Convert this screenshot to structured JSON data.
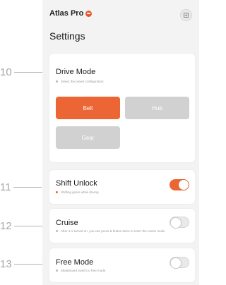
{
  "colors": {
    "accent": "#eb6634",
    "muted_option": "#d1d1d1",
    "panel_bg": "#f3f3f3"
  },
  "annotations": [
    "10",
    "11",
    "12",
    "13"
  ],
  "header": {
    "app_name": "Atlas Pro",
    "brand_icon": "brand-badge-icon",
    "corner_icon": "expand-icon",
    "page_title": "Settings"
  },
  "drive_mode": {
    "title": "Drive Mode",
    "description": "Select the power configuration",
    "options": [
      {
        "label": "Belt",
        "selected": true
      },
      {
        "label": "Hub",
        "selected": false
      },
      {
        "label": "Gear",
        "selected": false
      }
    ]
  },
  "shift_unlock": {
    "title": "Shift Unlock",
    "description": "Shifting gears while driving",
    "enabled": true,
    "dot_color": "#eb6634"
  },
  "cruise": {
    "title": "Cruise",
    "description": "After it is turned on, you can press & button twice to enter the cruise mode",
    "enabled": false
  },
  "free_mode": {
    "title": "Free Mode",
    "description": "Skateboard switch to free mode",
    "enabled": false
  }
}
